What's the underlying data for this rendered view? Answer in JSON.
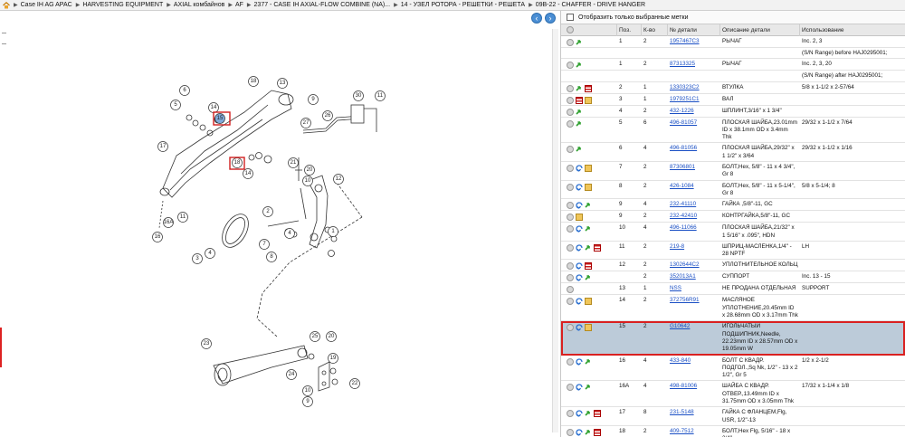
{
  "breadcrumbs": [
    "Case IH AG APAC",
    "HARVESTING EQUIPMENT",
    "AXIAL комбайнов",
    "AF",
    "2377 - CASE IH AXIAL-FLOW COMBINE (NA)...",
    "14 - УЗЕЛ РОТОРА - РЕШЕТКИ - РЕШЕТА",
    "09B-22 - CHAFFER - DRIVE HANGER"
  ],
  "filter_label": "Отобразить только выбранные метки",
  "columns": {
    "pos": "Поз.",
    "qty": "К-во",
    "num": "№ детали",
    "desc": "Описание детали",
    "use": "Использование"
  },
  "diagram": {
    "callouts": [
      "18",
      "13",
      "6",
      "15",
      "5",
      "14",
      "9",
      "30",
      "11",
      "27",
      "26",
      "17",
      "18",
      "14",
      "21",
      "20",
      "10",
      "12",
      "2",
      "1",
      "4",
      "7",
      "8",
      "16A",
      "11",
      "16",
      "3",
      "4",
      "23",
      "24",
      "25",
      "20",
      "19",
      "22",
      "9",
      "10"
    ]
  },
  "rows": [
    {
      "icons": [
        "circle",
        "green"
      ],
      "pos": "1",
      "qty": "2",
      "num": "1957467C3",
      "desc": "РЫЧАГ",
      "use": "Inc. 2, 3"
    },
    {
      "icons": [],
      "pos": "",
      "qty": "",
      "num": "",
      "desc": "",
      "use": "(S/N Range) before HAJ0295001;"
    },
    {
      "icons": [
        "circle",
        "green"
      ],
      "pos": "1",
      "qty": "2",
      "num": "87313325",
      "desc": "РЫЧАГ",
      "use": "Inc. 2, 3, 20"
    },
    {
      "icons": [],
      "pos": "",
      "qty": "",
      "num": "",
      "desc": "",
      "use": "(S/N Range) after HAJ0295001;"
    },
    {
      "icons": [
        "circle",
        "green",
        "red"
      ],
      "pos": "2",
      "qty": "1",
      "num": "1330323C2",
      "desc": "ВТУЛКА",
      "use": "5/8 x 1-1/2 x 2-57/64"
    },
    {
      "icons": [
        "circle",
        "red",
        "box"
      ],
      "pos": "3",
      "qty": "1",
      "num": "1979251C1",
      "desc": "ВАЛ",
      "use": ""
    },
    {
      "icons": [
        "circle",
        "green"
      ],
      "pos": "4",
      "qty": "2",
      "num": "432-1226",
      "desc": "ШПЛИНТ,3/16\" x 1 3/4\"",
      "use": ""
    },
    {
      "icons": [
        "circle",
        "green"
      ],
      "pos": "5",
      "qty": "6",
      "num": "496-81057",
      "desc": "ПЛОСКАЯ ШАЙБА,23.01mm ID x 38.1mm OD x 3.4mm Thk",
      "use": "29/32 x 1-1/2 x 7/64"
    },
    {
      "icons": [
        "circle",
        "green"
      ],
      "pos": "6",
      "qty": "4",
      "num": "496-81056",
      "desc": "ПЛОСКАЯ ШАЙБА,29/32\" x 1 1/2\" x 3/64",
      "use": "29/32 x 1-1/2 x 1/16"
    },
    {
      "icons": [
        "circle",
        "blue",
        "box"
      ],
      "pos": "7",
      "qty": "2",
      "num": "87306801",
      "desc": "БОЛТ,Hex, 5/8\" - 11 x 4 3/4\", Gr 8",
      "use": ""
    },
    {
      "icons": [
        "circle",
        "blue",
        "box"
      ],
      "pos": "8",
      "qty": "2",
      "num": "426-1084",
      "desc": "БОЛТ,Hex, 5/8\" - 11 x 5-1/4\", Gr 8",
      "use": "5/8 x 5-1/4; 8"
    },
    {
      "icons": [
        "circle",
        "blue",
        "green"
      ],
      "pos": "9",
      "qty": "4",
      "num": "232-41110",
      "desc": "ГАЙКА ,5/8\"-11, GC",
      "use": ""
    },
    {
      "icons": [
        "circle",
        "box"
      ],
      "pos": "9",
      "qty": "2",
      "num": "232-42410",
      "desc": "КОНТРГАЙКА,5/8\"-11, GC",
      "use": ""
    },
    {
      "icons": [
        "circle",
        "blue",
        "green"
      ],
      "pos": "10",
      "qty": "4",
      "num": "496-11066",
      "desc": "ПЛОСКАЯ ШАЙБА,21/32\" x 1 5/16\" x .095\", HDN",
      "use": ""
    },
    {
      "icons": [
        "circle",
        "blue",
        "green",
        "red"
      ],
      "pos": "11",
      "qty": "2",
      "num": "219-8",
      "desc": "ШПРИЦ-МАСЛЕНКА,1/4\" - 28 NPTF",
      "use": "LH"
    },
    {
      "icons": [
        "circle",
        "blue",
        "red"
      ],
      "pos": "12",
      "qty": "2",
      "num": "1302644C2",
      "desc": "УПЛОТНИТЕЛЬНОЕ КОЛЬЦ",
      "use": ""
    },
    {
      "icons": [
        "circle",
        "blue",
        "green"
      ],
      "pos": "",
      "qty": "2",
      "num": "352013A1",
      "desc": "СУППОРТ",
      "use": "Inc. 13 - 15"
    },
    {
      "icons": [
        "circle"
      ],
      "pos": "13",
      "qty": "1",
      "num": "NSS",
      "desc": "НЕ ПРОДАНА ОТДЕЛЬНАЯ",
      "use": "SUPPORT"
    },
    {
      "icons": [
        "circle",
        "blue",
        "box"
      ],
      "pos": "14",
      "qty": "2",
      "num": "372756R91",
      "desc": "МАСЛЯНОЕ УПЛОТНЕНИЕ,20.45mm ID x 28.68mm OD x 3.17mm Thk",
      "use": ""
    },
    {
      "icons": [
        "circle",
        "blue",
        "box"
      ],
      "pos": "15",
      "qty": "2",
      "num": "G10642",
      "desc": "ИГОЛЬЧАТЫЙ ПОДШИПНИК,Needle, 22.23mm ID x 28.57mm OD x 19.05mm W",
      "use": "",
      "selected": true
    },
    {
      "icons": [
        "circle",
        "blue",
        "green"
      ],
      "pos": "16",
      "qty": "4",
      "num": "433-840",
      "desc": "БОЛТ С КВАДР. ПОДГОЛ.,Sq Nk, 1/2\" - 13 x 2 1/2\", Gr 5",
      "use": "1/2 x 2-1/2"
    },
    {
      "icons": [
        "circle",
        "blue",
        "green"
      ],
      "pos": "16A",
      "qty": "4",
      "num": "498-81006",
      "desc": "ШАЙБА С КВАДР. ОТВЕР.,13.49mm ID x 31.75mm OD x 3.05mm Thk",
      "use": "17/32 x 1-1/4 x 1/8"
    },
    {
      "icons": [
        "circle",
        "blue",
        "green",
        "red"
      ],
      "pos": "17",
      "qty": "8",
      "num": "231-5148",
      "desc": "ГАЙКА С ФЛАНЦЕМ,Flg, USR, 1/2\"-13",
      "use": ""
    },
    {
      "icons": [
        "circle",
        "blue",
        "green",
        "red"
      ],
      "pos": "18",
      "qty": "2",
      "num": "409-7512",
      "desc": "БОЛТ,Hex Flg, 5/16\" - 18 x 3/4\",",
      "use": ""
    }
  ]
}
